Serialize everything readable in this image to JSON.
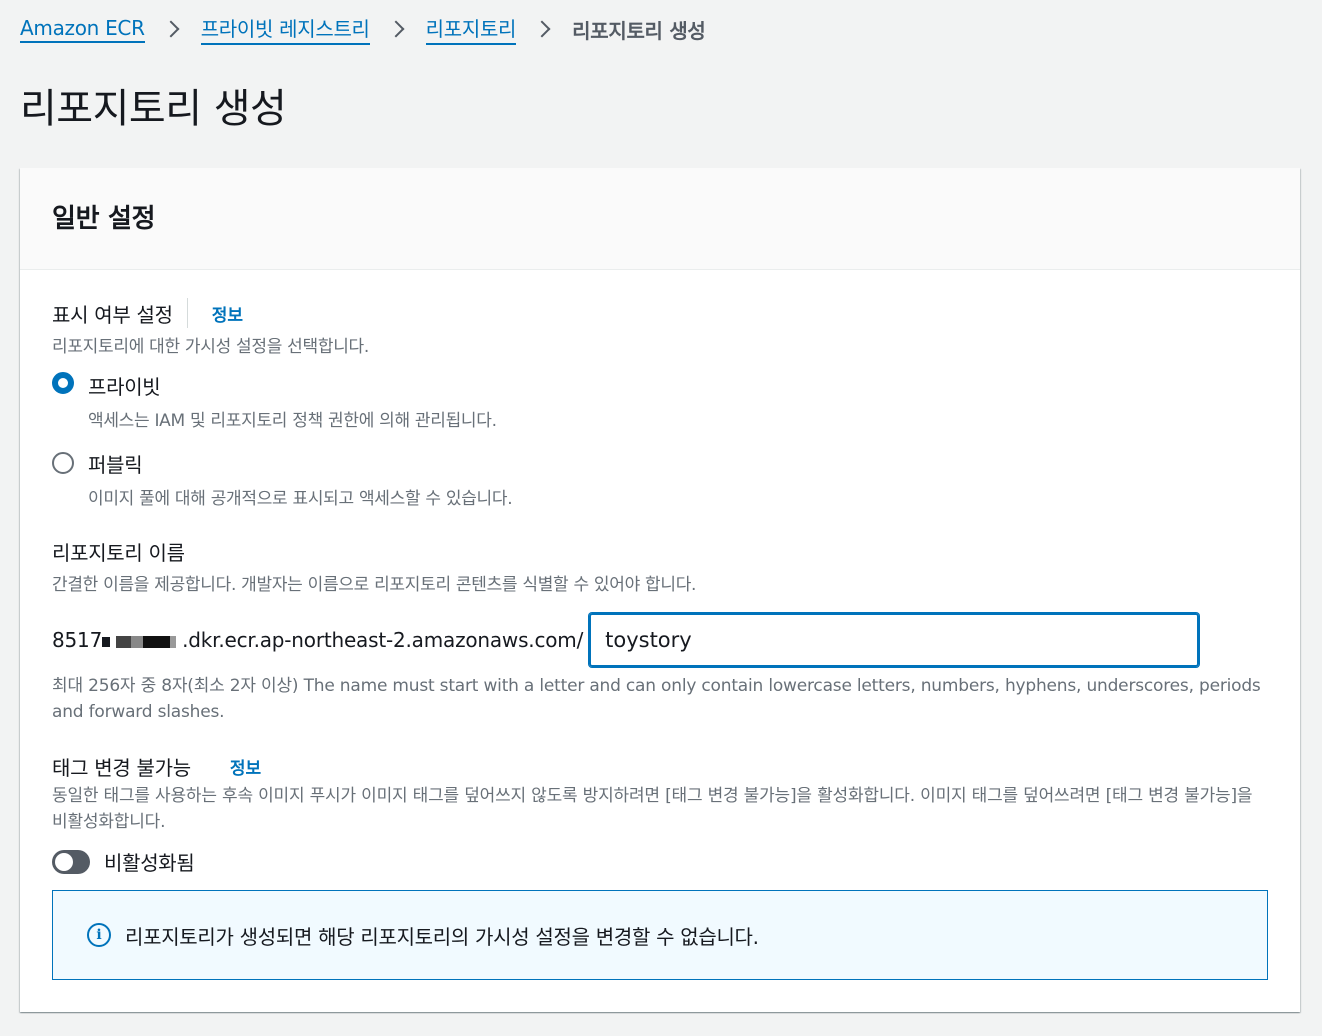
{
  "breadcrumb": {
    "items": [
      "Amazon ECR",
      "프라이빗 레지스트리",
      "리포지토리"
    ],
    "current": "리포지토리 생성"
  },
  "page": {
    "title": "리포지토리 생성"
  },
  "panel": {
    "title": "일반 설정",
    "visibility": {
      "label": "표시 여부 설정",
      "info": "정보",
      "description": "리포지토리에 대한 가시성 설정을 선택합니다.",
      "options": [
        {
          "label": "프라이빗",
          "description": "액세스는 IAM 및 리포지토리 정책 권한에 의해 관리됩니다.",
          "checked": true
        },
        {
          "label": "퍼블릭",
          "description": "이미지 풀에 대해 공개적으로 표시되고 액세스할 수 있습니다.",
          "checked": false
        }
      ]
    },
    "repo_name": {
      "label": "리포지토리 이름",
      "description": "간결한 이름을 제공합니다. 개발자는 이름으로 리포지토리 콘텐츠를 식별할 수 있어야 합니다.",
      "uri_prefix_start": "8517",
      "uri_prefix_end": ".dkr.ecr.ap-northeast-2.amazonaws.com/",
      "value": "toystory",
      "constraint": "최대 256자 중 8자(최소 2자 이상) The name must start with a letter and can only contain lowercase letters, numbers, hyphens, underscores, periods and forward slashes."
    },
    "immutability": {
      "label": "태그 변경 불가능",
      "info": "정보",
      "description": "동일한 태그를 사용하는 후속 이미지 푸시가 이미지 태그를 덮어쓰지 않도록 방지하려면 [태그 변경 불가능]을 활성화합니다. 이미지 태그를 덮어쓰려면 [태그 변경 불가능]을 비활성화합니다.",
      "toggle_label": "비활성화됨",
      "enabled": false
    },
    "alert": {
      "icon": "info-icon",
      "text": "리포지토리가 생성되면 해당 리포지토리의 가시성 설정을 변경할 수 없습니다."
    }
  },
  "colors": {
    "link": "#0073bb",
    "toggle_off": "#545b64",
    "alert_bg": "#f1faff"
  }
}
